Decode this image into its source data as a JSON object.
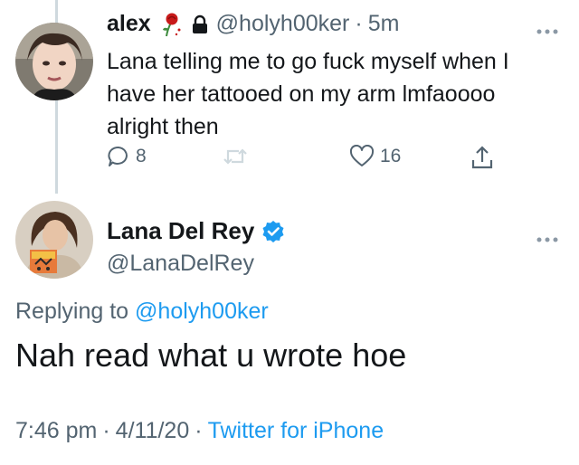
{
  "reply_tweet": {
    "name": "alex",
    "handle": "@holyh00ker",
    "separator": "·",
    "time_ago": "5m",
    "text": "Lana telling me to go fuck myself when I have her tattooed on my arm lmfaoooo alright then",
    "reply_count": "8",
    "like_count": "16"
  },
  "main_tweet": {
    "name": "Lana Del Rey",
    "handle": "@LanaDelRey",
    "replying_prefix": "Replying to",
    "replying_mention": "@holyh00ker",
    "text": "Nah read what u wrote hoe",
    "time": "7:46 pm",
    "date": "4/11/20",
    "separator": "·",
    "source": "Twitter for iPhone"
  },
  "colors": {
    "text": "#14171a",
    "secondary": "#536471",
    "link": "#1d9bf0",
    "verified": "#1d9bf0",
    "thread_line": "#cfd9de"
  },
  "icons": {
    "reply": "reply-icon",
    "retweet": "retweet-icon",
    "like": "heart-icon",
    "share": "share-icon",
    "verified": "verified-badge-icon",
    "lock": "lock-icon",
    "rose": "rose-emoji-icon",
    "more": "more-dots-icon"
  }
}
